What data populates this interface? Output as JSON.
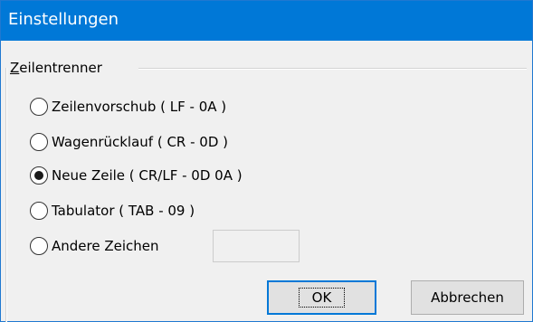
{
  "window": {
    "title": "Einstellungen"
  },
  "group": {
    "label_accel": "Z",
    "label_rest": "eilentrenner"
  },
  "options": [
    {
      "label": "Zeilenvorschub ( LF - 0A )",
      "checked": false
    },
    {
      "label": "Wagenrücklauf ( CR - 0D )",
      "checked": false
    },
    {
      "label": "Neue Zeile ( CR/LF - 0D 0A )",
      "checked": true
    },
    {
      "label": "Tabulator ( TAB - 09 )",
      "checked": false
    },
    {
      "label": "Andere Zeichen",
      "checked": false
    }
  ],
  "other_input": {
    "value": ""
  },
  "buttons": {
    "ok": "OK",
    "cancel": "Abbrechen"
  },
  "colors": {
    "title_bar": "#0078d7",
    "background": "#f0f0f0",
    "default_button_border": "#0078d7"
  }
}
